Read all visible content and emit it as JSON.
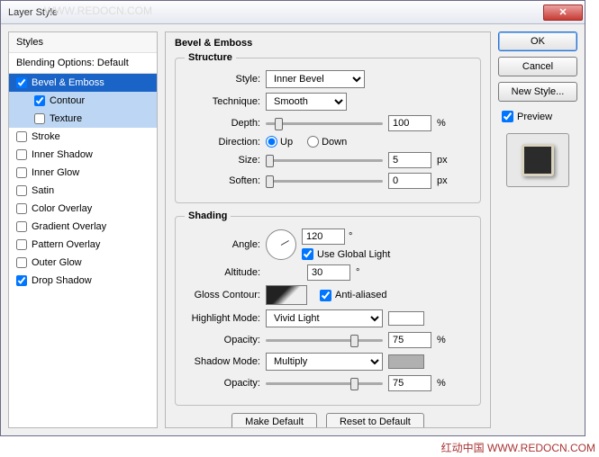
{
  "window": {
    "title": "Layer Style"
  },
  "watermark": {
    "top": "WWW.REDOCN.COM",
    "bottom": "红动中国 WWW.REDOCN.COM"
  },
  "sidebar": {
    "header": "Styles",
    "blending": "Blending Options: Default",
    "items": [
      {
        "label": "Bevel & Emboss",
        "checked": true
      },
      {
        "label": "Contour",
        "checked": true
      },
      {
        "label": "Texture",
        "checked": false
      },
      {
        "label": "Stroke",
        "checked": false
      },
      {
        "label": "Inner Shadow",
        "checked": false
      },
      {
        "label": "Inner Glow",
        "checked": false
      },
      {
        "label": "Satin",
        "checked": false
      },
      {
        "label": "Color Overlay",
        "checked": false
      },
      {
        "label": "Gradient Overlay",
        "checked": false
      },
      {
        "label": "Pattern Overlay",
        "checked": false
      },
      {
        "label": "Outer Glow",
        "checked": false
      },
      {
        "label": "Drop Shadow",
        "checked": true
      }
    ]
  },
  "panel": {
    "title": "Bevel & Emboss",
    "structure": {
      "legend": "Structure",
      "style_label": "Style:",
      "style_value": "Inner Bevel",
      "technique_label": "Technique:",
      "technique_value": "Smooth",
      "depth_label": "Depth:",
      "depth_value": "100",
      "depth_unit": "%",
      "direction_label": "Direction:",
      "dir_up": "Up",
      "dir_down": "Down",
      "size_label": "Size:",
      "size_value": "5",
      "size_unit": "px",
      "soften_label": "Soften:",
      "soften_value": "0",
      "soften_unit": "px"
    },
    "shading": {
      "legend": "Shading",
      "angle_label": "Angle:",
      "angle_value": "120",
      "deg": "°",
      "global_light": "Use Global Light",
      "altitude_label": "Altitude:",
      "altitude_value": "30",
      "gloss_label": "Gloss Contour:",
      "anti_aliased": "Anti-aliased",
      "highlight_mode_label": "Highlight Mode:",
      "highlight_mode_value": "Vivid Light",
      "opacity_label": "Opacity:",
      "highlight_opacity_value": "75",
      "opacity_unit": "%",
      "shadow_mode_label": "Shadow Mode:",
      "shadow_mode_value": "Multiply",
      "shadow_opacity_value": "75"
    },
    "buttons": {
      "make_default": "Make Default",
      "reset_default": "Reset to Default"
    }
  },
  "right": {
    "ok": "OK",
    "cancel": "Cancel",
    "new_style": "New Style...",
    "preview": "Preview"
  }
}
